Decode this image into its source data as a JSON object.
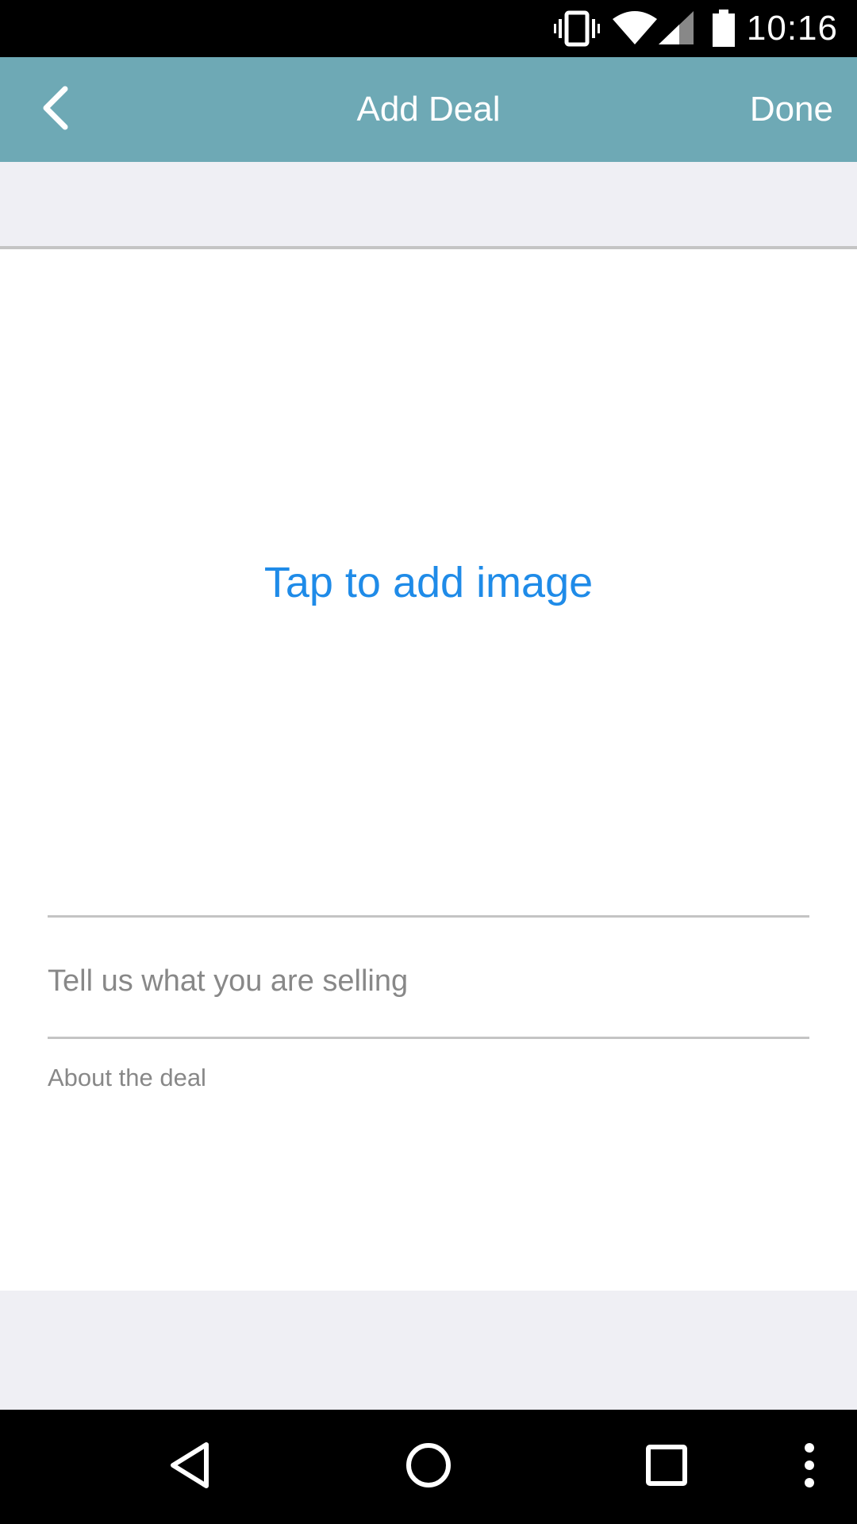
{
  "status_bar": {
    "time": "10:16",
    "icons": [
      "vibrate-icon",
      "wifi-icon",
      "cell-signal-icon",
      "battery-icon"
    ]
  },
  "app_bar": {
    "back_icon": "chevron-left-icon",
    "title": "Add Deal",
    "done_label": "Done",
    "color": "#6ea9b5"
  },
  "image_area": {
    "label": "Tap to add image",
    "label_color": "#1f8be8"
  },
  "form": {
    "title_placeholder": "Tell us what you are selling",
    "title_value": "",
    "about_placeholder": "About the deal",
    "about_value": ""
  },
  "nav_bar": {
    "icons": [
      "nav-back-icon",
      "nav-home-icon",
      "nav-recents-icon",
      "overflow-menu-icon"
    ]
  }
}
